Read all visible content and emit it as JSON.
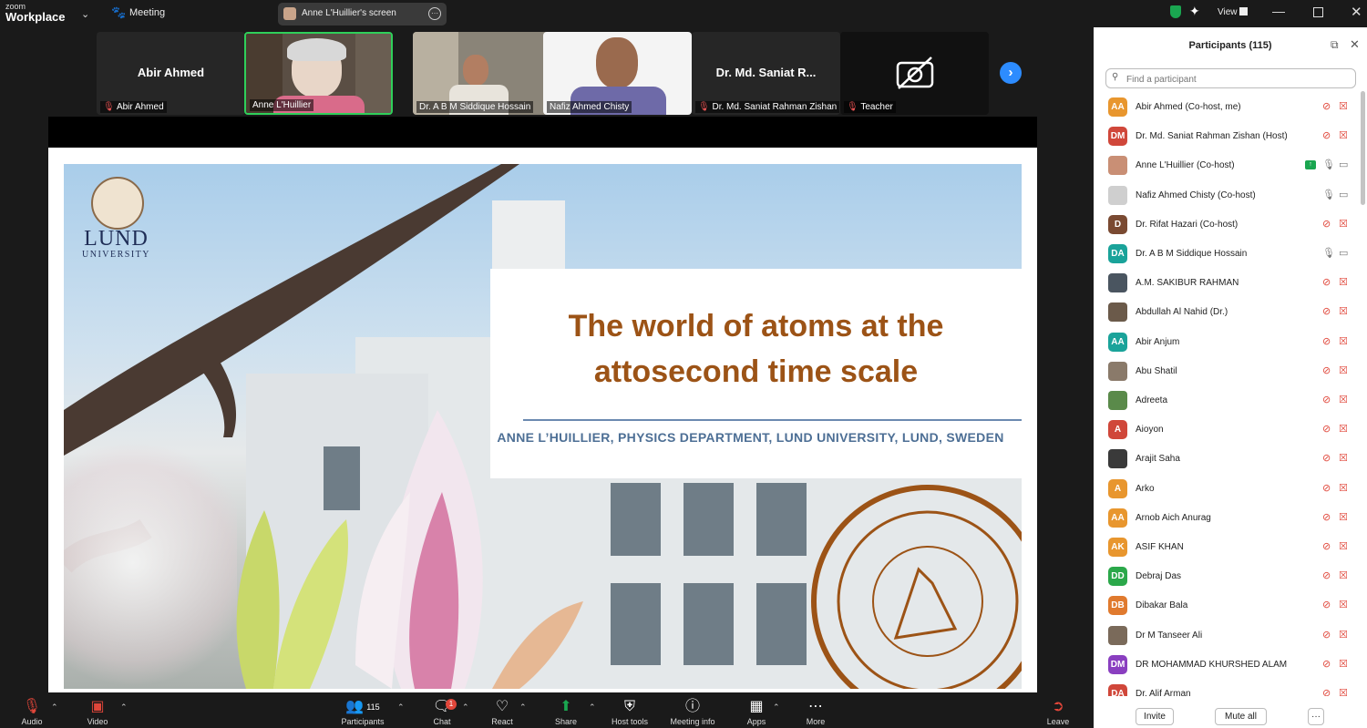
{
  "app": {
    "brand_top": "zoom",
    "brand_main": "Workplace",
    "meeting_label": "Meeting",
    "screen_label": "Anne L'Huillier's screen",
    "view_label": "View"
  },
  "thumbnails": [
    {
      "name": "Abir Ahmed",
      "center": "Abir Ahmed",
      "muted": true
    },
    {
      "name": "Anne L'Huillier",
      "center": "",
      "muted": false,
      "active": true
    },
    {
      "name": "Dr. A B M Siddique Hossain",
      "center": "",
      "muted": false
    },
    {
      "name": "Nafiz Ahmed Chisty",
      "center": "",
      "muted": false
    },
    {
      "name": "Dr. Md. Saniat Rahman Zishan",
      "center": "Dr. Md. Saniat R...",
      "muted": true
    },
    {
      "name": "Teacher",
      "center": "",
      "muted": true
    }
  ],
  "slide": {
    "title_line1": "The world of atoms at the",
    "title_line2": "attosecond time scale",
    "subtitle": "ANNE L’HUILLIER, PHYSICS DEPARTMENT, LUND UNIVERSITY, LUND, SWEDEN",
    "logo_line1": "LUND",
    "logo_line2": "UNIVERSITY"
  },
  "panel": {
    "title": "Participants (115)",
    "search_placeholder": "Find a participant",
    "invite_label": "Invite",
    "mute_all_label": "Mute all",
    "more_label": "···",
    "participants": [
      {
        "initials": "AA",
        "color": "#e8962e",
        "name": "Abir Ahmed (Co-host, me)",
        "mic": "muted",
        "video": "off"
      },
      {
        "initials": "DM",
        "color": "#d0473a",
        "name": "Dr. Md. Saniat Rahman Zishan (Host)",
        "mic": "muted",
        "video": "off"
      },
      {
        "initials": "",
        "color": "#c98f75",
        "name": "Anne L'Huillier (Co-host)",
        "mic": "on",
        "video": "on",
        "sharing": true
      },
      {
        "initials": "",
        "color": "#cfcfcf",
        "name": "Nafiz Ahmed Chisty (Co-host)",
        "mic": "on",
        "video": "on"
      },
      {
        "initials": "D",
        "color": "#7a4a32",
        "name": "Dr. Rifat Hazari (Co-host)",
        "mic": "muted",
        "video": "off"
      },
      {
        "initials": "DA",
        "color": "#1aa39a",
        "name": "Dr. A B M Siddique Hossain",
        "mic": "on",
        "video": "on"
      },
      {
        "initials": "",
        "color": "#4a5560",
        "name": "A.M. SAKIBUR RAHMAN",
        "mic": "muted",
        "video": "off"
      },
      {
        "initials": "",
        "color": "#6b5a4a",
        "name": "Abdullah Al Nahid (Dr.)",
        "mic": "muted",
        "video": "off"
      },
      {
        "initials": "AA",
        "color": "#1aa39a",
        "name": "Abir Anjum",
        "mic": "muted",
        "video": "off"
      },
      {
        "initials": "",
        "color": "#8a7a6a",
        "name": "Abu Shatil",
        "mic": "muted",
        "video": "off"
      },
      {
        "initials": "",
        "color": "#5a8a4a",
        "name": "Adreeta",
        "mic": "muted",
        "video": "off"
      },
      {
        "initials": "A",
        "color": "#d0473a",
        "name": "Aioyon",
        "mic": "muted",
        "video": "off"
      },
      {
        "initials": "",
        "color": "#3a3a3a",
        "name": "Arajit Saha",
        "mic": "muted",
        "video": "off"
      },
      {
        "initials": "A",
        "color": "#e8962e",
        "name": "Arko",
        "mic": "muted",
        "video": "off"
      },
      {
        "initials": "AA",
        "color": "#e8962e",
        "name": "Arnob Aich Anurag",
        "mic": "muted",
        "video": "off"
      },
      {
        "initials": "AK",
        "color": "#e8962e",
        "name": "ASIF KHAN",
        "mic": "muted",
        "video": "off"
      },
      {
        "initials": "DD",
        "color": "#2ba84a",
        "name": "Debraj Das",
        "mic": "muted",
        "video": "off"
      },
      {
        "initials": "DB",
        "color": "#e07a2e",
        "name": "Dibakar Bala",
        "mic": "muted",
        "video": "off"
      },
      {
        "initials": "",
        "color": "#7a6a5a",
        "name": "Dr M Tanseer Ali",
        "mic": "muted",
        "video": "off"
      },
      {
        "initials": "DM",
        "color": "#8a3fc0",
        "name": "DR MOHAMMAD KHURSHED ALAM",
        "mic": "muted",
        "video": "off"
      },
      {
        "initials": "DA",
        "color": "#d0473a",
        "name": "Dr. Alif Arman",
        "mic": "muted",
        "video": "off"
      }
    ]
  },
  "toolbar": {
    "audio": "Audio",
    "video": "Video",
    "participants": "Participants",
    "participants_count": "115",
    "chat": "Chat",
    "chat_badge": "1",
    "react": "React",
    "share": "Share",
    "host_tools": "Host tools",
    "meeting_info": "Meeting info",
    "apps": "Apps",
    "more": "More",
    "leave": "Leave"
  },
  "colors": {
    "accent": "#2d8cff",
    "title_orange": "#9c5316",
    "subtitle_blue": "#4d6f95",
    "muted_red": "#e0463a"
  }
}
